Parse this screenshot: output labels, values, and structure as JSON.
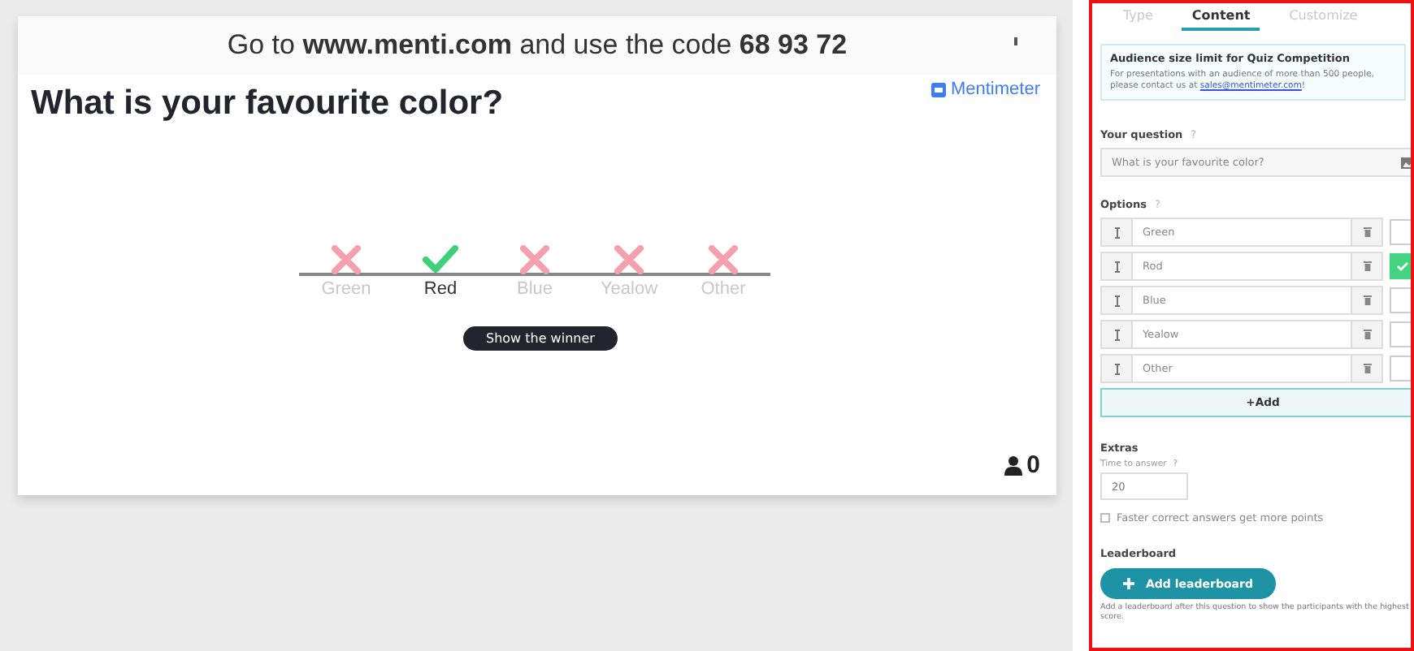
{
  "slide": {
    "instruction": "Go to **www.menti.com** and use the code **68 93 72**",
    "brand": "Mentimeter",
    "question": "What is your favourite color?",
    "results": [
      {
        "label": "Green",
        "correct": false
      },
      {
        "label": "Red",
        "correct": true
      },
      {
        "label": "Blue",
        "correct": false
      },
      {
        "label": "Yealow",
        "correct": false
      },
      {
        "label": "Other",
        "correct": false
      }
    ],
    "winner_button": "Show the winner",
    "participants": "0"
  },
  "panel": {
    "tabs": [
      {
        "label": "Type",
        "selected": false
      },
      {
        "label": "Content",
        "selected": true
      },
      {
        "label": "Customize",
        "selected": false
      }
    ],
    "notice": {
      "title": "Audience size limit for Quiz Competition",
      "text": "For presentations with an audience of more than 500 people, please contact us at ",
      "link": "sales@mentimeter.com",
      "after": "!"
    },
    "question_label": "Your question",
    "question_help": "?",
    "question_value": "What is your favourite color?",
    "options_label": "Options",
    "options_help": "?",
    "options": [
      {
        "text": "Green",
        "correct": false
      },
      {
        "text": "Rod",
        "correct": true
      },
      {
        "text": "Blue",
        "correct": false
      },
      {
        "text": "Yealow",
        "correct": false
      },
      {
        "text": "Other",
        "correct": false
      }
    ],
    "add_button": "+Add",
    "extras_label": "Extras",
    "time_label": "Time to answer",
    "time_help": "?",
    "time_value": "20",
    "faster_points": {
      "label": "Faster correct answers get more points",
      "checked": false
    },
    "leaderboard_label": "Leaderboard",
    "leaderboard_button": "Add leaderboard",
    "leaderboard_note": "Add a leaderboard after this question to show the participants with the highest score."
  }
}
